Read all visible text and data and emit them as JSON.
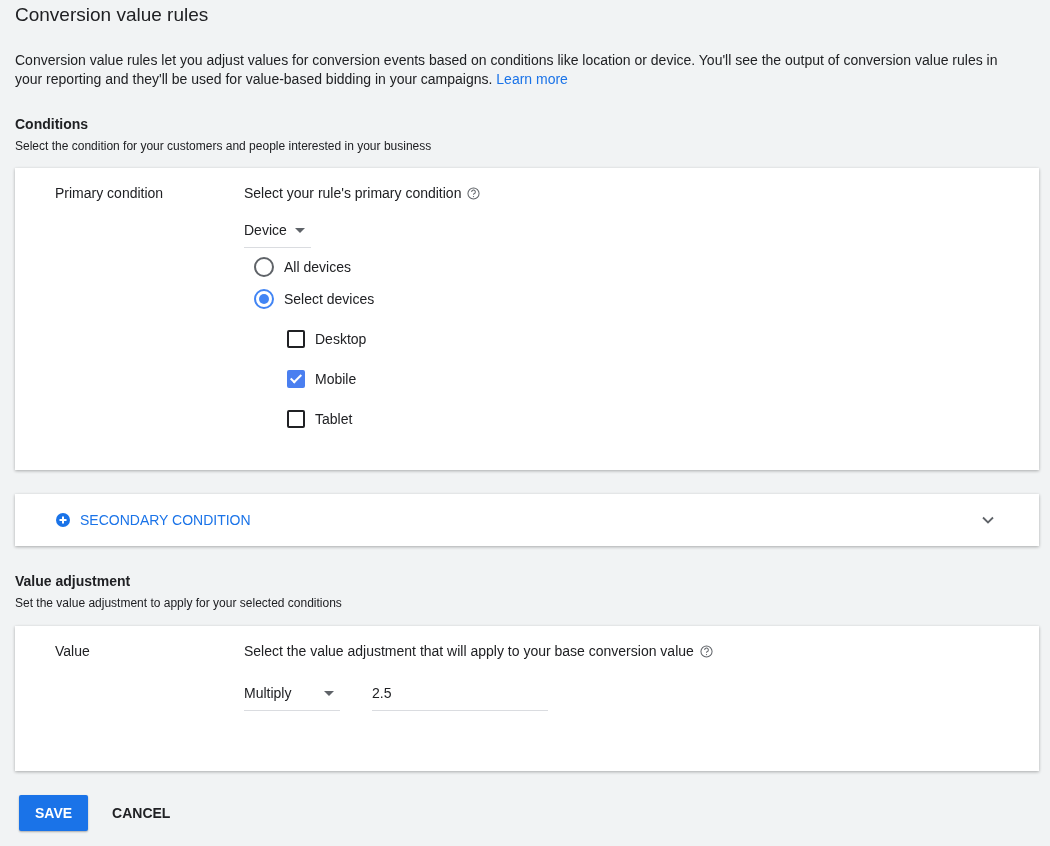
{
  "title": "Conversion value rules",
  "intro": {
    "text": "Conversion value rules let you adjust values for conversion events based on conditions like location or device. You'll see the output of conversion value rules in your reporting and they'll be used for value-based bidding in your campaigns.",
    "link": "Learn more"
  },
  "conditions": {
    "heading": "Conditions",
    "subtitle": "Select the condition for your customers and people interested in your business",
    "primary": {
      "label": "Primary condition",
      "prompt": "Select your rule's primary condition",
      "dropdown": "Device",
      "options": [
        {
          "label": "All devices",
          "selected": false
        },
        {
          "label": "Select devices",
          "selected": true
        }
      ],
      "devices": [
        {
          "label": "Desktop",
          "checked": false
        },
        {
          "label": "Mobile",
          "checked": true
        },
        {
          "label": "Tablet",
          "checked": false
        }
      ]
    }
  },
  "secondary": {
    "label": "SECONDARY CONDITION",
    "expanded": false
  },
  "value_adjustment": {
    "heading": "Value adjustment",
    "subtitle": "Set the value adjustment to apply for your selected conditions",
    "label": "Value",
    "prompt": "Select the value adjustment that will apply to your base conversion value",
    "operation": "Multiply",
    "value": "2.5"
  },
  "buttons": [
    {
      "label": "SAVE",
      "kind": "primary"
    },
    {
      "label": "CANCEL",
      "kind": "text"
    }
  ]
}
